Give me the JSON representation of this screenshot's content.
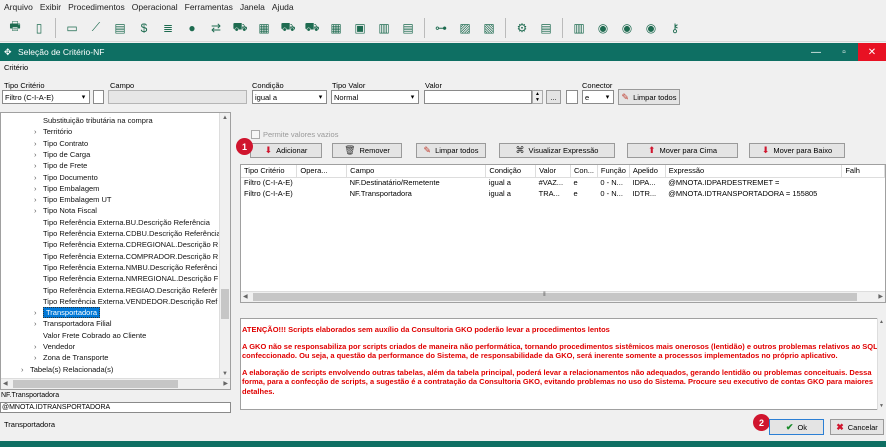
{
  "menu": [
    "Arquivo",
    "Exibir",
    "Procedimentos",
    "Operacional",
    "Ferramentas",
    "Janela",
    "Ajuda"
  ],
  "window": {
    "title": "Seleção de Critério-NF"
  },
  "form": {
    "section_label": "Critério",
    "tipo_criterio_label": "Tipo Critério",
    "tipo_criterio_value": "Filtro (C-I-A-E)",
    "campo_label": "Campo",
    "campo_value": "",
    "condicao_label": "Condição",
    "condicao_value": "igual a",
    "tipo_valor_label": "Tipo Valor",
    "tipo_valor_value": "Normal",
    "valor_label": "Valor",
    "valor_value": "",
    "browse_label": "...",
    "conector_label": "Conector",
    "conector_value": "e",
    "limpar_todos_label": "Limpar todos"
  },
  "tree": {
    "items": [
      {
        "label": "Substituição tributária na compra",
        "chev": false,
        "indent": 1
      },
      {
        "label": "Território",
        "chev": true,
        "indent": 1
      },
      {
        "label": "Tipo Contrato",
        "chev": true,
        "indent": 1
      },
      {
        "label": "Tipo de Carga",
        "chev": true,
        "indent": 1
      },
      {
        "label": "Tipo de Frete",
        "chev": true,
        "indent": 1
      },
      {
        "label": "Tipo Documento",
        "chev": true,
        "indent": 1
      },
      {
        "label": "Tipo Embalagem",
        "chev": true,
        "indent": 1
      },
      {
        "label": "Tipo Embalagem UT",
        "chev": true,
        "indent": 1
      },
      {
        "label": "Tipo Nota Fiscal",
        "chev": true,
        "indent": 1
      },
      {
        "label": "Tipo Referência Externa.BU.Descrição Referência",
        "chev": false,
        "indent": 1
      },
      {
        "label": "Tipo Referência Externa.CDBU.Descrição Referência",
        "chev": false,
        "indent": 1
      },
      {
        "label": "Tipo Referência Externa.CDREGIONAL.Descrição R",
        "chev": false,
        "indent": 1
      },
      {
        "label": "Tipo Referência Externa.COMPRADOR.Descrição R",
        "chev": false,
        "indent": 1
      },
      {
        "label": "Tipo Referência Externa.NMBU.Descrição Referênci",
        "chev": false,
        "indent": 1
      },
      {
        "label": "Tipo Referência Externa.NMREGIONAL.Descrição F",
        "chev": false,
        "indent": 1
      },
      {
        "label": "Tipo Referência Externa.REGIAO.Descrição Referêr",
        "chev": false,
        "indent": 1
      },
      {
        "label": "Tipo Referência Externa.VENDEDOR.Descrição Ref",
        "chev": false,
        "indent": 1
      },
      {
        "label": "Transportadora",
        "chev": true,
        "indent": 1,
        "selected": true
      },
      {
        "label": "Transportadora Filial",
        "chev": true,
        "indent": 1
      },
      {
        "label": "Valor Frete Cobrado ao Cliente",
        "chev": false,
        "indent": 1
      },
      {
        "label": "Vendedor",
        "chev": true,
        "indent": 1
      },
      {
        "label": "Zona de Transporte",
        "chev": true,
        "indent": 1
      },
      {
        "label": "Tabela(s) Relacionada(s)",
        "chev": true,
        "indent": 0
      }
    ]
  },
  "footer_left": {
    "path": "NF.Transportadora",
    "expression": "@MNOTA.IDTRANSPORTADORA",
    "description": "Transportadora"
  },
  "actions": {
    "permite_vazios": "Permite valores vazios",
    "adicionar": "Adicionar",
    "remover": "Remover",
    "limpar_todos": "Limpar todos",
    "visualizar": "Visualizar Expressão",
    "mover_cima": "Mover para Cima",
    "mover_baixo": "Mover para Baixo"
  },
  "grid": {
    "columns": [
      "Tipo Critério",
      "Opera...",
      "Campo",
      "Condição",
      "Valor",
      "Con...",
      "Função",
      "Apelido",
      "Expressão",
      "Falh"
    ],
    "rows": [
      [
        "Filtro (C-I-A-E)",
        "",
        "NF.Destinatário/Remetente",
        "igual a",
        "#VAZ...",
        "e",
        "0 - N...",
        "IDPA...",
        "@MNOTA.IDPARDESTREMET =",
        ""
      ],
      [
        "Filtro (C-I-A-E)",
        "",
        "NF.Transportadora",
        "igual a",
        "TRA...",
        "e",
        "0 - N...",
        "IDTR...",
        "@MNOTA.IDTRANSPORTADORA = 155805",
        ""
      ]
    ]
  },
  "warning": {
    "p1": "ATENÇÃO!!! Scripts elaborados sem auxílio da Consultoria GKO poderão levar a procedimentos lentos",
    "p2": "A GKO não se responsabiliza por scripts criados de maneira não performática, tornando procedimentos sistêmicos mais onerosos (lentidão) e outros problemas relativos ao SQL confeccionado. Ou seja, a questão da performance do Sistema, de responsabilidade da GKO, será inerente somente a processos implementados no próprio aplicativo.",
    "p3": "A elaboração de scripts envolvendo outras tabelas, além da tabela principal, poderá levar a relacionamentos não adequados, gerando lentidão ou problemas conceituais. Dessa forma, para a confecção de scripts, a sugestão é a contratação da Consultoria GKO, evitando problemas no uso do Sistema. Procure seu executivo de contas GKO para maiores detalhes."
  },
  "dialog": {
    "ok": "Ok",
    "cancel": "Cancelar"
  },
  "badges": {
    "b1": "1",
    "b2": "2"
  },
  "colors": {
    "titlebar": "#0e6f63",
    "warning": "#e00000",
    "badge": "#d0152e",
    "close": "#e81123"
  }
}
